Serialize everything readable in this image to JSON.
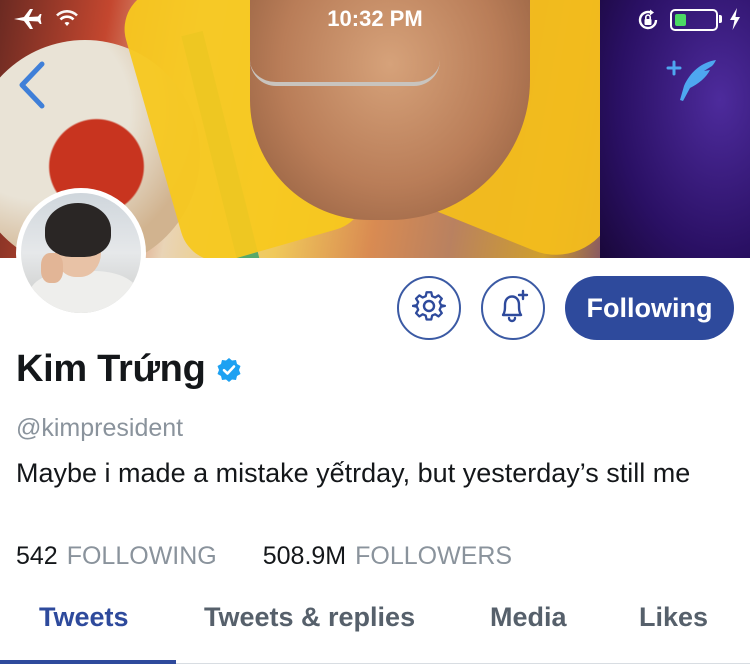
{
  "status_bar": {
    "time": "10:32 PM",
    "battery_level": 0.3,
    "icons": [
      "airplane-icon",
      "wifi-icon",
      "rotation-lock-icon",
      "battery-icon",
      "charging-bolt-icon"
    ]
  },
  "header": {
    "back_icon": "chevron-left-icon",
    "compose_icon": "quill-sparkle-icon"
  },
  "profile": {
    "display_name": "Kim Trứng",
    "verified": true,
    "handle": "@kimpresident",
    "bio": "Maybe i made a mistake yếtrday, but yesterday’s still me",
    "following_count": "542",
    "following_label": "FOLLOWING",
    "followers_count": "508.9M",
    "followers_label": "FOLLOWERS"
  },
  "actions": {
    "settings_icon": "gear-icon",
    "notify_icon": "bell-plus-icon",
    "following_label": "Following"
  },
  "tabs": [
    {
      "label": "Tweets",
      "active": true
    },
    {
      "label": "Tweets & replies",
      "active": false
    },
    {
      "label": "Media",
      "active": false
    },
    {
      "label": "Likes",
      "active": false
    }
  ],
  "colors": {
    "accent": "#2e4a9c",
    "muted": "#8a939c",
    "verified": "#1da1f2",
    "back_arrow": "#3f7fd8",
    "compose": "#4ea7f0"
  }
}
